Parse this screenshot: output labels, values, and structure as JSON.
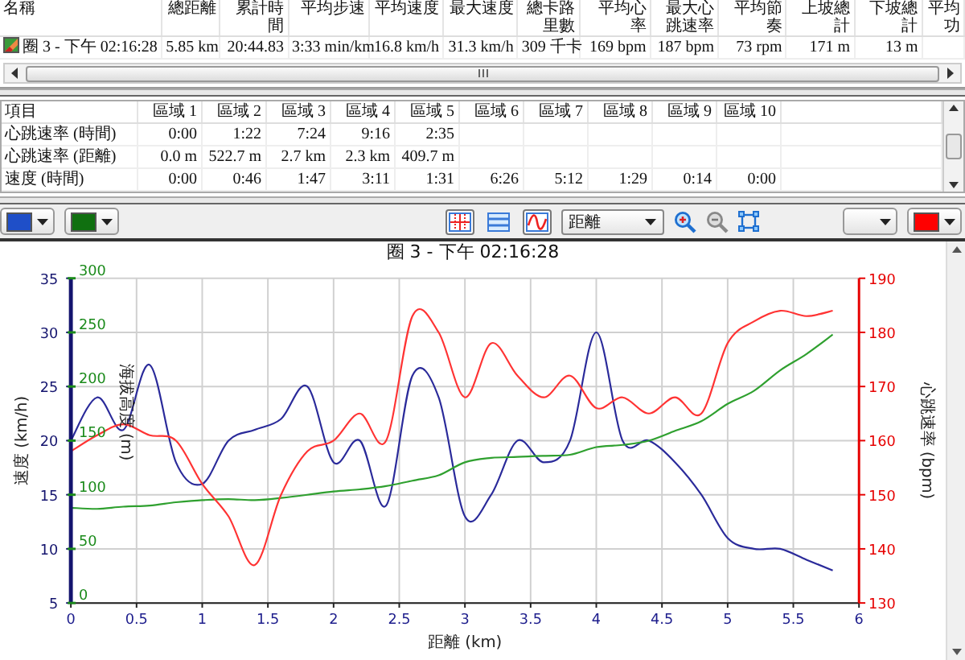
{
  "laps_table": {
    "columns": [
      "名稱",
      "總距離",
      "累計時間",
      "平均步速",
      "平均速度",
      "最大速度",
      "總卡路里數",
      "平均心率",
      "最大心跳速率",
      "平均節奏",
      "上坡總計",
      "下坡總計",
      "平均功"
    ],
    "rows": [
      {
        "cells": [
          "圈 3 - 下午 02:16:28",
          "5.85 km",
          "20:44.83",
          "3:33 min/km",
          "16.8 km/h",
          "31.3 km/h",
          "309 千卡",
          "169 bpm",
          "187 bpm",
          "73 rpm",
          "171 m",
          "13 m"
        ]
      }
    ]
  },
  "zones_table": {
    "columns": [
      "項目",
      "區域 1",
      "區域 2",
      "區域 3",
      "區域 4",
      "區域 5",
      "區域 6",
      "區域 7",
      "區域 8",
      "區域 9",
      "區域 10"
    ],
    "rows": [
      {
        "label": "心跳速率 (時間)",
        "values": [
          "0:00",
          "1:22",
          "7:24",
          "9:16",
          "2:35"
        ]
      },
      {
        "label": "心跳速率 (距離)",
        "values": [
          "0.0 m",
          "522.7 m",
          "2.7 km",
          "2.3 km",
          "409.7 m"
        ]
      },
      {
        "label": "速度 (時間)",
        "values": [
          "0:00",
          "0:46",
          "1:47",
          "3:11",
          "1:31",
          "6:26",
          "5:12",
          "1:29",
          "0:14",
          "0:00"
        ]
      }
    ]
  },
  "toolbar": {
    "color_pickers_left": [
      {
        "kind": "swatch",
        "color": "#1f4fc8"
      },
      {
        "kind": "swatch",
        "color": "#107010"
      }
    ],
    "view_toggles": [
      {
        "kind": "grid",
        "selected": true
      },
      {
        "kind": "lines",
        "selected": false
      },
      {
        "kind": "wave",
        "selected": true
      }
    ],
    "x_axis_select": {
      "value": "距離"
    },
    "zoom_tools": [
      {
        "kind": "zoom_in"
      },
      {
        "kind": "zoom_out"
      },
      {
        "kind": "fit"
      }
    ],
    "color_pickers_right": [
      {
        "kind": "blank"
      },
      {
        "kind": "swatch",
        "color": "#ff0000"
      }
    ]
  },
  "chart": {
    "chart_data": {
      "type": "line",
      "grid": true,
      "title": "圈 3 - 下午 02:16:28",
      "xlabel": "距離 (km)",
      "ylabel": "速度 (km/h)",
      "y2label": "海拔高度 (m)",
      "y3label": "心跳速率 (bpm)",
      "xlim": [
        0,
        6
      ],
      "ylim": [
        5,
        35
      ],
      "y2lim": [
        0,
        300
      ],
      "y3lim": [
        130,
        190
      ],
      "xticks": [
        0,
        0.5,
        1,
        1.5,
        2,
        2.5,
        3,
        3.5,
        4,
        4.5,
        5,
        5.5,
        6
      ],
      "yticks": [
        5,
        10,
        15,
        20,
        25,
        30,
        35
      ],
      "y2ticks": [
        0,
        50,
        100,
        150,
        200,
        250,
        300
      ],
      "y3ticks": [
        130,
        140,
        150,
        160,
        170,
        180,
        190
      ],
      "x": [
        0,
        0.2,
        0.4,
        0.6,
        0.8,
        1,
        1.2,
        1.4,
        1.6,
        1.8,
        2,
        2.2,
        2.4,
        2.6,
        2.8,
        3,
        3.2,
        3.4,
        3.6,
        3.8,
        4,
        4.2,
        4.4,
        4.6,
        4.8,
        5,
        5.2,
        5.4,
        5.6,
        5.8
      ],
      "series": [
        {
          "color": "#2a2a9a",
          "values": [
            20,
            24,
            21,
            27,
            18,
            16,
            20,
            21,
            22,
            25,
            18,
            20,
            14,
            26,
            24,
            13,
            15,
            20,
            18,
            20,
            30,
            20,
            20,
            18,
            15,
            11,
            10,
            10,
            9,
            8
          ]
        },
        {
          "axis": "y2",
          "color": "#2fa02f",
          "values": [
            88,
            87,
            89,
            90,
            93,
            95,
            96,
            95,
            97,
            100,
            103,
            105,
            108,
            113,
            118,
            130,
            134,
            135,
            136,
            137,
            144,
            146,
            150,
            159,
            168,
            184,
            196,
            215,
            230,
            248
          ]
        },
        {
          "axis": "y3",
          "color": "#ff3333",
          "values": [
            158,
            161,
            163,
            161,
            160,
            152,
            146,
            137,
            150,
            158,
            160,
            165,
            160,
            183,
            180,
            168,
            178,
            172,
            168,
            172,
            166,
            168,
            165,
            168,
            165,
            178,
            182,
            184,
            183,
            184
          ]
        }
      ]
    }
  }
}
